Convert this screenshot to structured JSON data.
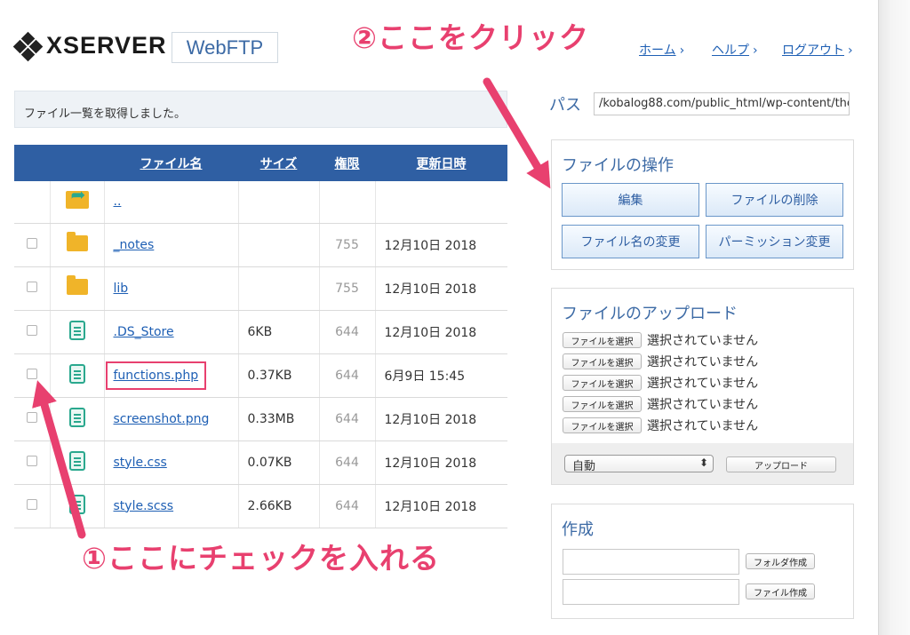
{
  "header": {
    "logo_text": "XSERVER",
    "app_label": "WebFTP",
    "nav": [
      {
        "label": "ホーム",
        "icon": "chevron-right-icon"
      },
      {
        "label": "ヘルプ",
        "icon": "chevron-right-icon"
      },
      {
        "label": "ログアウト",
        "icon": "chevron-right-icon"
      }
    ]
  },
  "annotations": {
    "step2": "②ここをクリック",
    "step1": "①ここにチェックを入れる",
    "color": "#e8406f"
  },
  "message": "ファイル一覧を取得しました。",
  "table": {
    "columns": [
      "ファイル名",
      "サイズ",
      "権限",
      "更新日時"
    ],
    "parent_link": "..",
    "rows": [
      {
        "name": "_notes",
        "size": "",
        "perm": "755",
        "date": "12月10日 2018",
        "icon": "folder-icon"
      },
      {
        "name": "lib",
        "size": "",
        "perm": "755",
        "date": "12月10日 2018",
        "icon": "folder-icon"
      },
      {
        "name": ".DS_Store",
        "size": "6KB",
        "perm": "644",
        "date": "12月10日 2018",
        "icon": "file-icon"
      },
      {
        "name": "functions.php",
        "size": "0.37KB",
        "perm": "644",
        "date": "6月9日 15:45",
        "icon": "file-icon"
      },
      {
        "name": "screenshot.png",
        "size": "0.33MB",
        "perm": "644",
        "date": "12月10日 2018",
        "icon": "file-icon"
      },
      {
        "name": "style.css",
        "size": "0.07KB",
        "perm": "644",
        "date": "12月10日 2018",
        "icon": "file-icon"
      },
      {
        "name": "style.scss",
        "size": "2.66KB",
        "perm": "644",
        "date": "12月10日 2018",
        "icon": "file-icon"
      }
    ]
  },
  "path": {
    "label": "パス",
    "value": "/kobalog88.com/public_html/wp-content/the"
  },
  "operations": {
    "title": "ファイルの操作",
    "edit": "編集",
    "delete": "ファイルの削除",
    "rename": "ファイル名の変更",
    "permission": "パーミッション変更"
  },
  "upload": {
    "title": "ファイルのアップロード",
    "choose_label": "ファイルを選択",
    "none_selected": "選択されていません",
    "mode": "自動",
    "upload_button": "アップロード"
  },
  "create": {
    "title": "作成",
    "folder_button": "フォルダ作成",
    "file_button": "ファイル作成"
  }
}
